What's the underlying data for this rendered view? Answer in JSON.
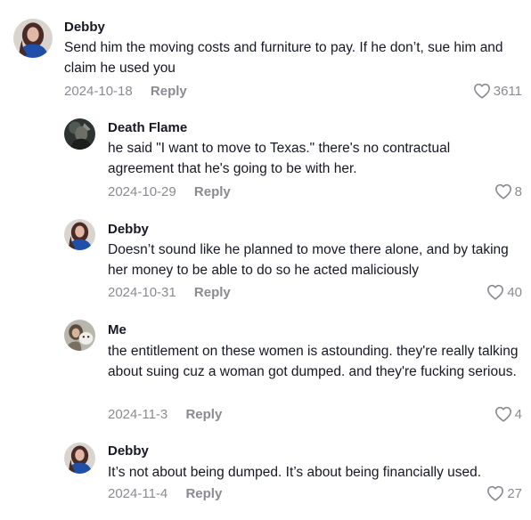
{
  "comments": [
    {
      "username": "Debby",
      "avatar_icon": "avatar-woman-blue",
      "text": "Send him the moving costs and furniture to pay. If he don’t, sue him and claim he used you",
      "date": "2024-10-18",
      "reply_label": "Reply",
      "likes": "3611"
    },
    {
      "username": "Death Flame",
      "avatar_icon": "avatar-dark-figure",
      "text": "he said \"I want to move to Texas.\" there's no contractual agreement that he's going to be with her.",
      "date": "2024-10-29",
      "reply_label": "Reply",
      "likes": "8"
    },
    {
      "username": "Debby",
      "avatar_icon": "avatar-woman-blue",
      "text": "Doesn’t sound like he planned to move there alone, and by taking her money to be able to do so he acted maliciously",
      "date": "2024-10-31",
      "reply_label": "Reply",
      "likes": "40"
    },
    {
      "username": "Me",
      "avatar_icon": "avatar-pet-photo",
      "text": "the entitlement on these women is astounding. they're really talking about suing cuz a woman got dumped. and they're fucking serious.",
      "date": "2024-11-3",
      "reply_label": "Reply",
      "likes": "4"
    },
    {
      "username": "Debby",
      "avatar_icon": "avatar-woman-blue",
      "text": "It’s not about being dumped. It’s about being financially used.",
      "date": "2024-11-4",
      "reply_label": "Reply",
      "likes": "27"
    }
  ],
  "colors": {
    "text_primary": "#161823",
    "text_secondary": "#8a8b91",
    "background": "#ffffff"
  },
  "icons": {
    "like": "heart-outline-icon"
  }
}
